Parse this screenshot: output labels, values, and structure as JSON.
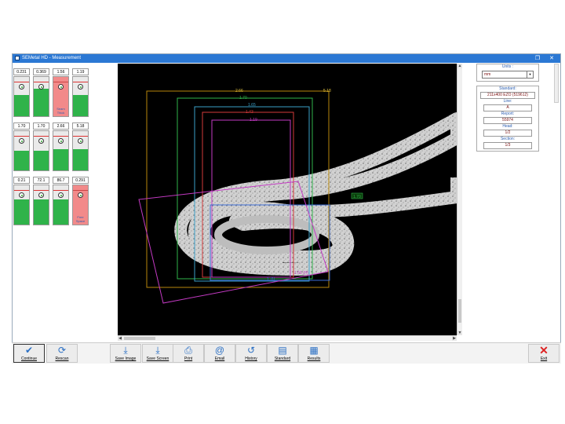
{
  "window": {
    "title": "SEMetal HD - Measurement"
  },
  "gauges": [
    {
      "value": "0.231",
      "status": "ok"
    },
    {
      "value": "0.369",
      "status": "ok"
    },
    {
      "value": "1.56",
      "status": "fail",
      "label": "Seam Thick"
    },
    {
      "value": "1.19",
      "status": "ok"
    },
    {
      "value": "1.70",
      "status": "ok"
    },
    {
      "value": "1.70",
      "status": "ok"
    },
    {
      "value": "2.66",
      "status": "ok"
    },
    {
      "value": "5.18",
      "status": "ok"
    },
    {
      "value": "0.21",
      "status": "ok"
    },
    {
      "value": "72.1",
      "status": "ok"
    },
    {
      "value": "86.7",
      "status": "ok"
    },
    {
      "value": "0.291",
      "status": "fail",
      "label": "Free Space"
    }
  ],
  "overlay": {
    "dims": [
      "2.66",
      "5.18",
      "1.70",
      "1.65",
      "1.43",
      "1.19",
      "1.70",
      "1.56 (H)",
      "1.70"
    ]
  },
  "side": {
    "units_label": "Units :",
    "units_value": "mm",
    "standard_label": "Standard:",
    "standard_value": "211x400 EZO (519612)",
    "line_label": "Line:",
    "line_value": "A",
    "report_label": "Report:",
    "report_value": "55974",
    "head_label": "Head:",
    "head_value": "1/2",
    "section_label": "Section:",
    "section_value": "1/3"
  },
  "toolbar": {
    "continue": "Continue",
    "rescan": "Rescan",
    "save_image": "Save Image",
    "save_screen": "Save Screen",
    "print": "Print",
    "email": "Email",
    "history": "History",
    "standard": "Standard",
    "results": "Results",
    "exit": "Exit"
  },
  "colors": {
    "ok": "#2fb34a",
    "fail": "#f28a8a",
    "accent": "#2b78d4"
  }
}
